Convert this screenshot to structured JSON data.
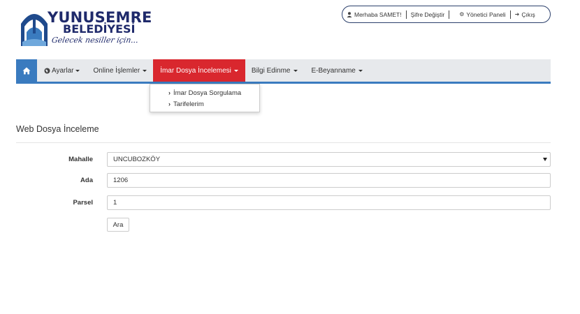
{
  "logo": {
    "title": "YUNUSEMRE",
    "subtitle": "BELEDİYESİ",
    "slogan": "Gelecek nesiller için..."
  },
  "userbox": {
    "greeting": "Merhaba SAMET!",
    "change_password": "Şifre Değiştir",
    "admin_panel": "Yönetici Paneli",
    "logout": "Çıkış"
  },
  "nav": {
    "items": [
      {
        "label": "Ayarlar"
      },
      {
        "label": "Online İşlemler"
      },
      {
        "label": "İmar Dosya İncelemesi"
      },
      {
        "label": "Bilgi Edinme"
      },
      {
        "label": "E-Beyanname"
      }
    ]
  },
  "dropdown": {
    "items": [
      {
        "label": "İmar Dosya Sorgulama"
      },
      {
        "label": "Tarifelerim"
      }
    ]
  },
  "page": {
    "title": "Web Dosya İnceleme"
  },
  "form": {
    "mahalle_label": "Mahalle",
    "mahalle_value": "UNCUBOZKÖY",
    "ada_label": "Ada",
    "ada_value": "1206",
    "parsel_label": "Parsel",
    "parsel_value": "1",
    "submit_label": "Ara"
  },
  "colors": {
    "nav_bg": "#e7e9ec",
    "home_bg": "#3a7bbf",
    "active_bg": "#d9272e",
    "brand": "#1f2a6b"
  }
}
